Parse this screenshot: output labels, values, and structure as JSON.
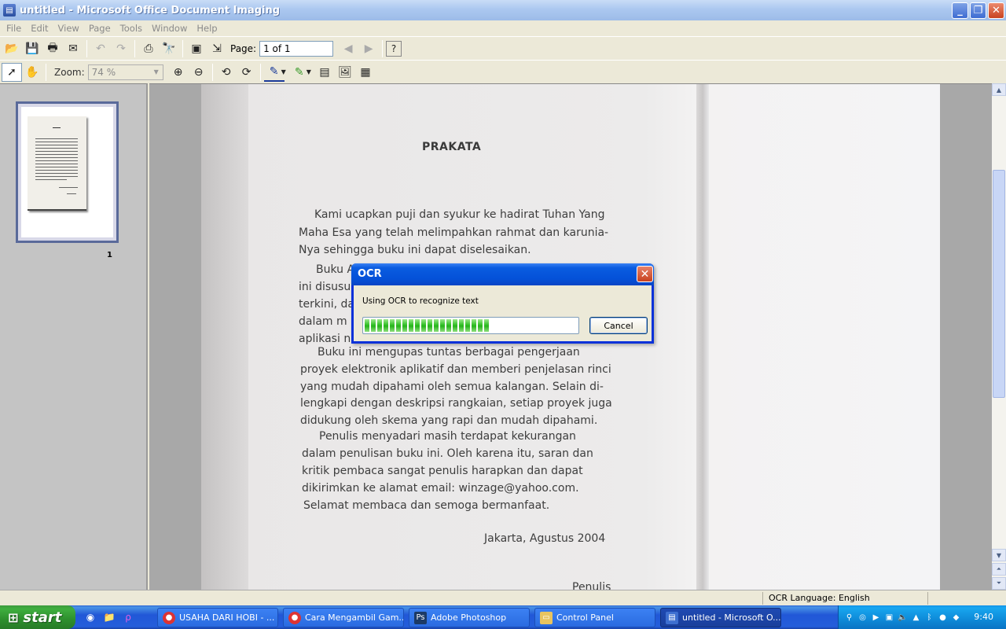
{
  "window": {
    "title": "untitled - Microsoft Office Document Imaging",
    "minimize": "_",
    "restore": "❐",
    "close": "✕"
  },
  "menu": [
    "File",
    "Edit",
    "View",
    "Page",
    "Tools",
    "Window",
    "Help"
  ],
  "toolbar": {
    "page_label": "Page:",
    "page_value": "1 of 1",
    "zoom_label": "Zoom:",
    "zoom_value": "74 %"
  },
  "thumbnails": {
    "page_number": "1"
  },
  "document": {
    "title": "PRAKATA",
    "lines": [
      "Kami ucapkan puji dan syukur ke hadirat Tuhan Yang",
      "Maha Esa yang telah melimpahkan rahmat dan karunia-",
      "Nya sehingga buku ini dapat diselesaikan.",
      "Buku A",
      "ini disusu",
      "terkini, da",
      "dalam m",
      "aplikasi n",
      "Buku ini mengupas tuntas berbagai pengerjaan",
      "proyek elektronik aplikatif dan memberi penjelasan rinci",
      "yang mudah dipahami oleh semua kalangan. Selain di-",
      "lengkapi dengan deskripsi rangkaian, setiap proyek juga",
      "didukung oleh skema yang rapi dan mudah dipahami.",
      "Penulis menyadari masih terdapat kekurangan",
      "dalam penulisan buku ini. Oleh karena itu, saran dan",
      "kritik pembaca sangat penulis harapkan dan dapat",
      "dikirimkan ke alamat email: winzage@yahoo.com.",
      "Selamat membaca dan semoga bermanfaat.",
      "Jakarta, Agustus 2004",
      "Penulis"
    ]
  },
  "dialog": {
    "title": "OCR",
    "message": "Using OCR to recognize text",
    "progress_percent": 60,
    "cancel_label": "Cancel"
  },
  "statusbar": {
    "ocr_language": "OCR Language: English"
  },
  "taskbar": {
    "start_label": "start",
    "tasks": [
      {
        "label": "USAHA DARI HOBI - ...",
        "icon": "chrome-icon"
      },
      {
        "label": "Cara Mengambil Gam...",
        "icon": "chrome-icon"
      },
      {
        "label": "Adobe Photoshop",
        "icon": "photoshop-icon"
      },
      {
        "label": "Control Panel",
        "icon": "control-panel-icon"
      },
      {
        "label": "untitled - Microsoft O...",
        "icon": "document-imaging-icon"
      }
    ],
    "clock": "9:40"
  }
}
